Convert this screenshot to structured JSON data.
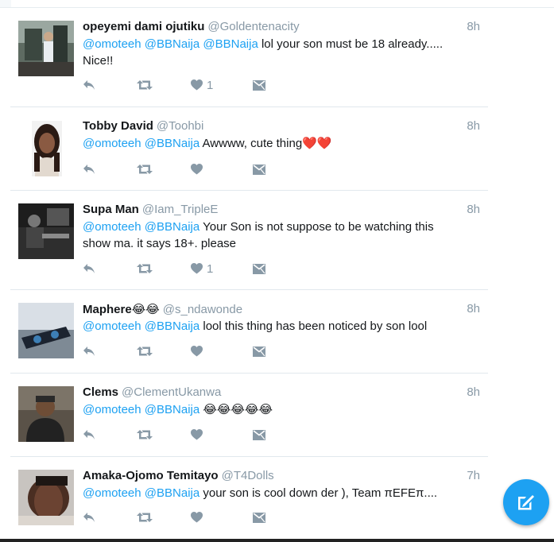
{
  "tweets": [
    {
      "name": "opeyemi dami ojutiku",
      "handle": "@Goldentenacity",
      "time": "8h",
      "mentions": [
        "@omoteeh",
        "@BBNaija",
        "@BBNaija"
      ],
      "text": "lol your son must be 18 already.....",
      "text2": "Nice!!",
      "likes": "1"
    },
    {
      "name": "Tobby David",
      "handle": "@Toohbi",
      "time": "8h",
      "mentions": [
        "@omoteeh",
        "@BBNaija"
      ],
      "text": "Awwww, cute thing",
      "emoji": "❤️❤️",
      "likes": ""
    },
    {
      "name": "Supa Man",
      "handle": "@Iam_TripleE",
      "time": "8h",
      "mentions": [
        "@omoteeh",
        "@BBNaija"
      ],
      "text": "Your Son is not suppose to be watching this",
      "text2": "show ma. it says 18+. please",
      "likes": "1"
    },
    {
      "name": "Maphere",
      "name_emoji": "😂😂",
      "handle": "@s_ndawonde",
      "time": "8h",
      "mentions": [
        "@omoteeh",
        "@BBNaija"
      ],
      "text": "lool this thing has been noticed by son lool",
      "likes": ""
    },
    {
      "name": "Clems",
      "handle": "@ClementUkanwa",
      "time": "8h",
      "mentions": [
        "@omoteeh",
        "@BBNaija"
      ],
      "emoji": "😂😂😂😂😂",
      "likes": ""
    },
    {
      "name": "Amaka-Ojomo Temitayo",
      "handle": "@T4Dolls",
      "time": "7h",
      "mentions": [
        "@omoteeh",
        "@BBNaija"
      ],
      "text": "your son is cool down der ), Team πEFEπ....",
      "likes": ""
    }
  ],
  "icons": {
    "reply": "reply-icon",
    "retweet": "retweet-icon",
    "like": "heart-icon",
    "dm": "direct-message-icon",
    "compose": "compose-tweet-icon"
  },
  "colors": {
    "link": "#1da1f2",
    "muted": "#8899a6",
    "heart": "#e0245e",
    "fab": "#1da1f2"
  }
}
